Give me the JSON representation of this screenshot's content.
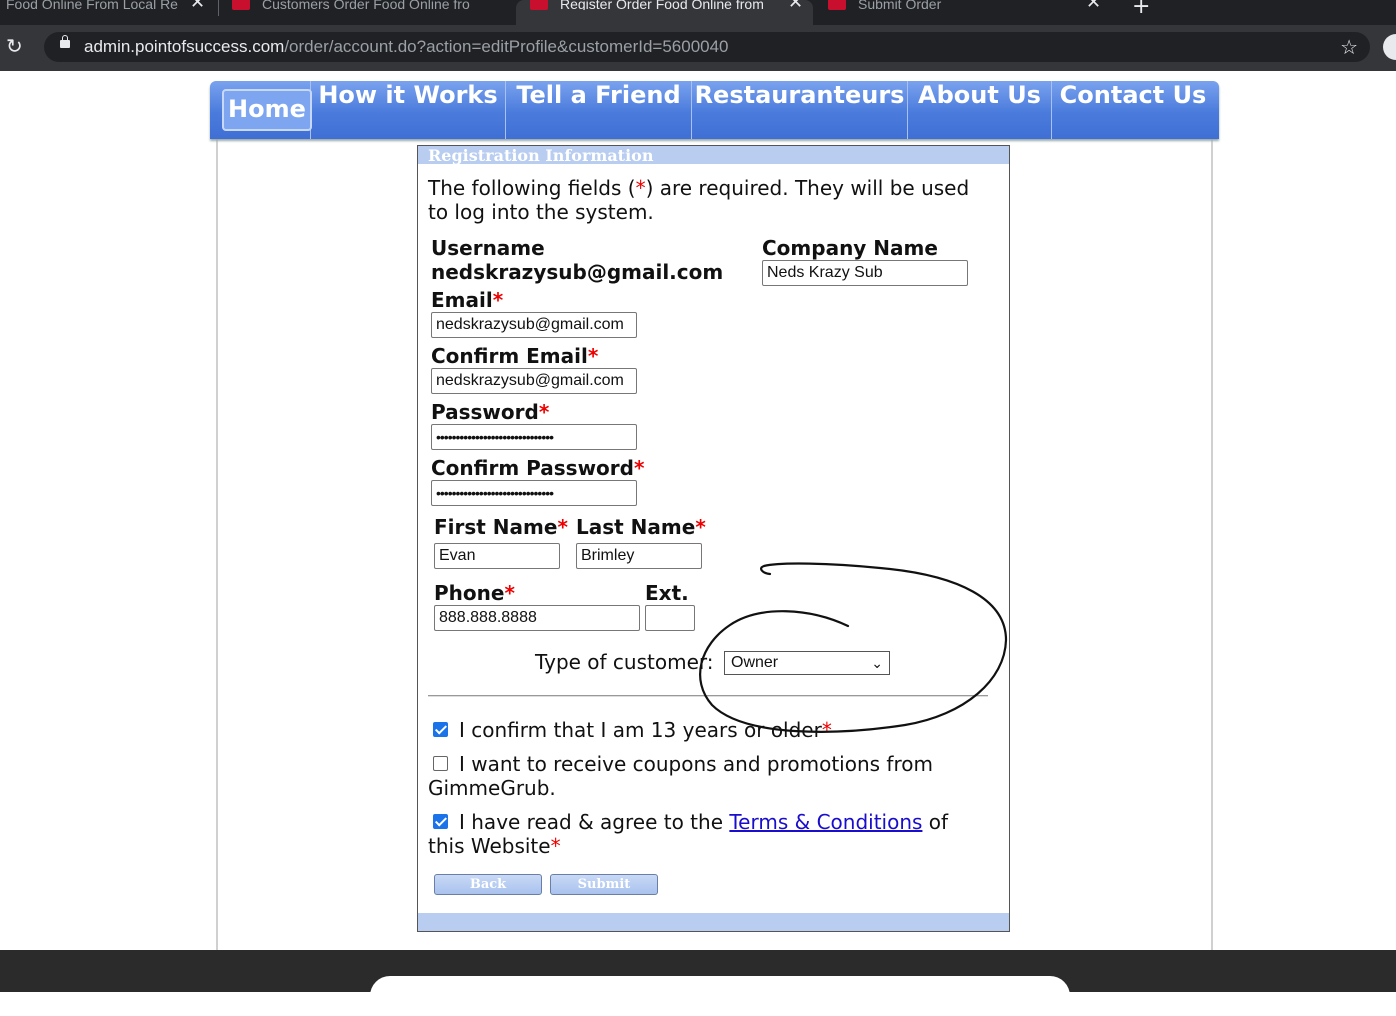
{
  "browser": {
    "tabs": [
      {
        "title": "Food Online From Local Re",
        "close": "✕"
      },
      {
        "title": "Customers Order Food Online fro",
        "close": "✕"
      },
      {
        "title": "Register Order Food Online from",
        "close": "✕"
      },
      {
        "title": "Submit Order",
        "close": "✕"
      }
    ],
    "new_tab": "+",
    "url_host": "admin.pointofsuccess.com",
    "url_path": "/order/account.do?action=editProfile&customerId=5600040",
    "reload": "↻",
    "star": "☆"
  },
  "nav": {
    "items": [
      "Home",
      "How it Works",
      "Tell a Friend",
      "Restauranteurs",
      "About Us",
      "Contact Us"
    ]
  },
  "form": {
    "heading": "Registration Information",
    "intro_line1_a": "The following fields (",
    "intro_star": "*",
    "intro_line1_b": ") are required. They will be used",
    "intro_line2": "to log into the system.",
    "username_label": "Username",
    "username_value": "nedskrazysub@gmail.com",
    "company_label": "Company Name",
    "company_value": "Neds Krazy Sub",
    "email_label": "Email",
    "email_value": "nedskrazysub@gmail.com",
    "confirm_email_label": "Confirm Email",
    "confirm_email_value": "nedskrazysub@gmail.com",
    "password_label": "Password",
    "password_value": "••••••••••••••••••••••••••••••",
    "confirm_password_label": "Confirm Password",
    "confirm_password_value": "••••••••••••••••••••••••••••••",
    "first_name_label": "First Name",
    "first_name_value": "Evan",
    "last_name_label": "Last Name",
    "last_name_value": "Brimley",
    "phone_label": "Phone",
    "phone_value": "888.888.8888",
    "ext_label": "Ext.",
    "ext_value": "",
    "customer_type_label": "Type of customer:",
    "customer_type_value": "Owner",
    "req_star": "*",
    "age_confirm": "I confirm that I am 13 years or older",
    "age_checked": true,
    "promo_line1": "I want to receive coupons and promotions from",
    "promo_line2": "GimmeGrub.",
    "promo_checked": false,
    "terms_a": "I have read & agree to the ",
    "terms_link": "Terms & Conditions",
    "terms_b": " of",
    "terms_line2": "this Website",
    "terms_checked": true,
    "back_label": "Back",
    "submit_label": "Submit"
  }
}
